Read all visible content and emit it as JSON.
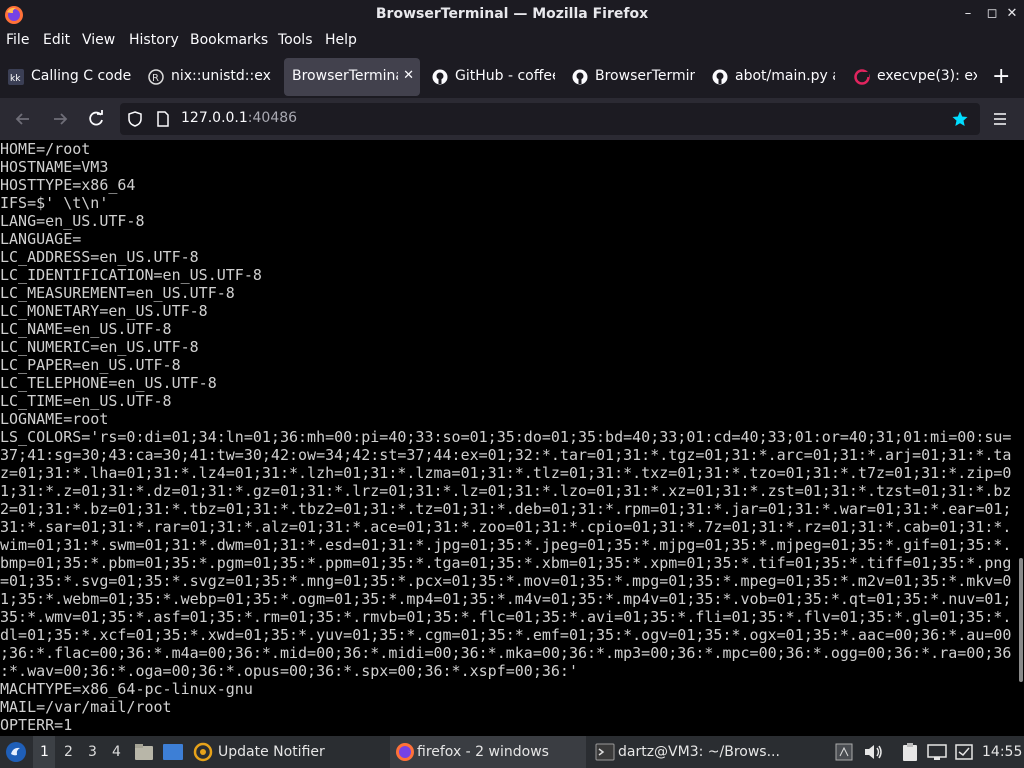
{
  "window": {
    "title": "BrowserTerminal — Mozilla Firefox",
    "minimize_glyph": "–",
    "maximize_glyph": "◻",
    "close_glyph": "✕"
  },
  "menu": [
    "File",
    "Edit",
    "View",
    "History",
    "Bookmarks",
    "Tools",
    "Help"
  ],
  "tabs": [
    {
      "label": "Calling C code",
      "icon": "kk-favicon",
      "active": false
    },
    {
      "label": "nix::unistd::ex",
      "icon": "rust-favicon",
      "active": false
    },
    {
      "label": "BrowserTermina",
      "icon": "none",
      "active": true,
      "close": "✕"
    },
    {
      "label": "GitHub - coffee",
      "icon": "github-icon",
      "active": false
    },
    {
      "label": "BrowserTermin",
      "icon": "github-icon",
      "active": false
    },
    {
      "label": "abot/main.py a",
      "icon": "github-icon",
      "active": false
    },
    {
      "label": "execvpe(3): ex",
      "icon": "man-favicon",
      "active": false
    }
  ],
  "new_tab_glyph": "+",
  "navbar": {
    "url_host": "127.0.0.1",
    "url_port": ":40486"
  },
  "terminal": {
    "lines": [
      "HOME=/root",
      "HOSTNAME=VM3",
      "HOSTTYPE=x86_64",
      "IFS=$' \\t\\n'",
      "LANG=en_US.UTF-8",
      "LANGUAGE=",
      "LC_ADDRESS=en_US.UTF-8",
      "LC_IDENTIFICATION=en_US.UTF-8",
      "LC_MEASUREMENT=en_US.UTF-8",
      "LC_MONETARY=en_US.UTF-8",
      "LC_NAME=en_US.UTF-8",
      "LC_NUMERIC=en_US.UTF-8",
      "LC_PAPER=en_US.UTF-8",
      "LC_TELEPHONE=en_US.UTF-8",
      "LC_TIME=en_US.UTF-8",
      "LOGNAME=root",
      "LS_COLORS='rs=0:di=01;34:ln=01;36:mh=00:pi=40;33:so=01;35:do=01;35:bd=40;33;01:cd=40;33;01:or=40;31;01:mi=00:su=",
      "37;41:sg=30;43:ca=30;41:tw=30;42:ow=34;42:st=37;44:ex=01;32:*.tar=01;31:*.tgz=01;31:*.arc=01;31:*.arj=01;31:*.ta",
      "z=01;31:*.lha=01;31:*.lz4=01;31:*.lzh=01;31:*.lzma=01;31:*.tlz=01;31:*.txz=01;31:*.tzo=01;31:*.t7z=01;31:*.zip=0",
      "1;31:*.z=01;31:*.dz=01;31:*.gz=01;31:*.lrz=01;31:*.lz=01;31:*.lzo=01;31:*.xz=01;31:*.zst=01;31:*.tzst=01;31:*.bz",
      "2=01;31:*.bz=01;31:*.tbz=01;31:*.tbz2=01;31:*.tz=01;31:*.deb=01;31:*.rpm=01;31:*.jar=01;31:*.war=01;31:*.ear=01;",
      "31:*.sar=01;31:*.rar=01;31:*.alz=01;31:*.ace=01;31:*.zoo=01;31:*.cpio=01;31:*.7z=01;31:*.rz=01;31:*.cab=01;31:*.",
      "wim=01;31:*.swm=01;31:*.dwm=01;31:*.esd=01;31:*.jpg=01;35:*.jpeg=01;35:*.mjpg=01;35:*.mjpeg=01;35:*.gif=01;35:*.",
      "bmp=01;35:*.pbm=01;35:*.pgm=01;35:*.ppm=01;35:*.tga=01;35:*.xbm=01;35:*.xpm=01;35:*.tif=01;35:*.tiff=01;35:*.png",
      "=01;35:*.svg=01;35:*.svgz=01;35:*.mng=01;35:*.pcx=01;35:*.mov=01;35:*.mpg=01;35:*.mpeg=01;35:*.m2v=01;35:*.mkv=0",
      "1;35:*.webm=01;35:*.webp=01;35:*.ogm=01;35:*.mp4=01;35:*.m4v=01;35:*.mp4v=01;35:*.vob=01;35:*.qt=01;35:*.nuv=01;",
      "35:*.wmv=01;35:*.asf=01;35:*.rm=01;35:*.rmvb=01;35:*.flc=01;35:*.avi=01;35:*.fli=01;35:*.flv=01;35:*.gl=01;35:*.",
      "dl=01;35:*.xcf=01;35:*.xwd=01;35:*.yuv=01;35:*.cgm=01;35:*.emf=01;35:*.ogv=01;35:*.ogx=01;35:*.aac=00;36:*.au=00",
      ";36:*.flac=00;36:*.m4a=00;36:*.mid=00;36:*.midi=00;36:*.mka=00;36:*.mp3=00;36:*.mpc=00;36:*.ogg=00;36:*.ra=00;36",
      ":*.wav=00;36:*.oga=00;36:*.opus=00;36:*.spx=00;36:*.xspf=00;36:'",
      "MACHTYPE=x86_64-pc-linux-gnu",
      "MAIL=/var/mail/root",
      "OPTERR=1"
    ]
  },
  "taskbar": {
    "workspaces": [
      "1",
      "2",
      "3",
      "4"
    ],
    "current_workspace": "1",
    "update_notifier_label": "Update Notifier",
    "firefox_task_label": "firefox - 2 windows",
    "terminal_task_label": "dartz@VM3: ~/Brows...",
    "clock": "14:55"
  },
  "colors": {
    "accent_star": "#00ddff",
    "terminal_bg": "#000000",
    "terminal_fg": "#d0d0d0"
  }
}
